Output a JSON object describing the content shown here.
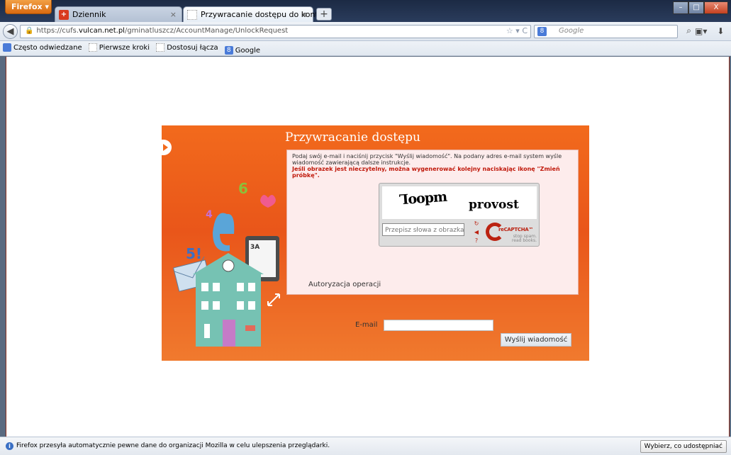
{
  "browser": {
    "menu_label": "Firefox",
    "tabs": [
      {
        "label": "Dziennik",
        "close": "×",
        "favicon": "dziennik-favicon"
      },
      {
        "label": "Przywracanie dostępu do konta",
        "close": "×",
        "favicon": "blank-page-favicon"
      }
    ],
    "new_tab": "+",
    "url_protocol": "https://cufs.",
    "url_domain": "vulcan.net.pl",
    "url_path": "/gminatluszcz/AccountManage/UnlockRequest",
    "search_placeholder": "Google",
    "search_engine_badge": "8",
    "window_controls": [
      "–",
      "□",
      "X"
    ]
  },
  "bookmarks": [
    {
      "label": "Często odwiedzane",
      "icon": "bookmark-folder-icon"
    },
    {
      "label": "Pierwsze kroki",
      "icon": "page-icon"
    },
    {
      "label": "Dostosuj łącza",
      "icon": "page-icon"
    },
    {
      "label": "Google",
      "icon": "google-icon"
    }
  ],
  "page": {
    "title": "Przywracanie dostępu",
    "instructions": "Podaj swój e-mail i naciśnij przycisk \"Wyślij wiadomość\". Na podany adres e-mail system wyśle wiadomość zawierającą dalsze instrukcje.",
    "warning": "Jeśli obrazek jest nieczytelny, można wygenerować kolejny naciskając ikonę \"Zmień próbkę\".",
    "auth_label": "Autoryzacja operacji",
    "captcha_word1": "Ꞁᴏᴏpm",
    "captcha_word2": "provost",
    "captcha_placeholder": "Przepisz słowa z obrazka",
    "recaptcha_brand": "reCAPTCHA™",
    "recaptcha_slogan": "stop spam. read books.",
    "email_label": "E-mail",
    "email_value": "",
    "send_button": "Wyślij wiadomość",
    "art_text": {
      "class": "3A",
      "number": "6",
      "number2": "5!",
      "number3": "4"
    }
  },
  "notification": {
    "text": "Firefox przesyła automatycznie pewne dane do organizacji Mozilla w celu ulepszenia przeglądarki.",
    "button": "Wybierz, co udostępniać"
  },
  "colors": {
    "panel": "#f26a1c",
    "warning": "#c0180a",
    "box": "#fdecec"
  }
}
